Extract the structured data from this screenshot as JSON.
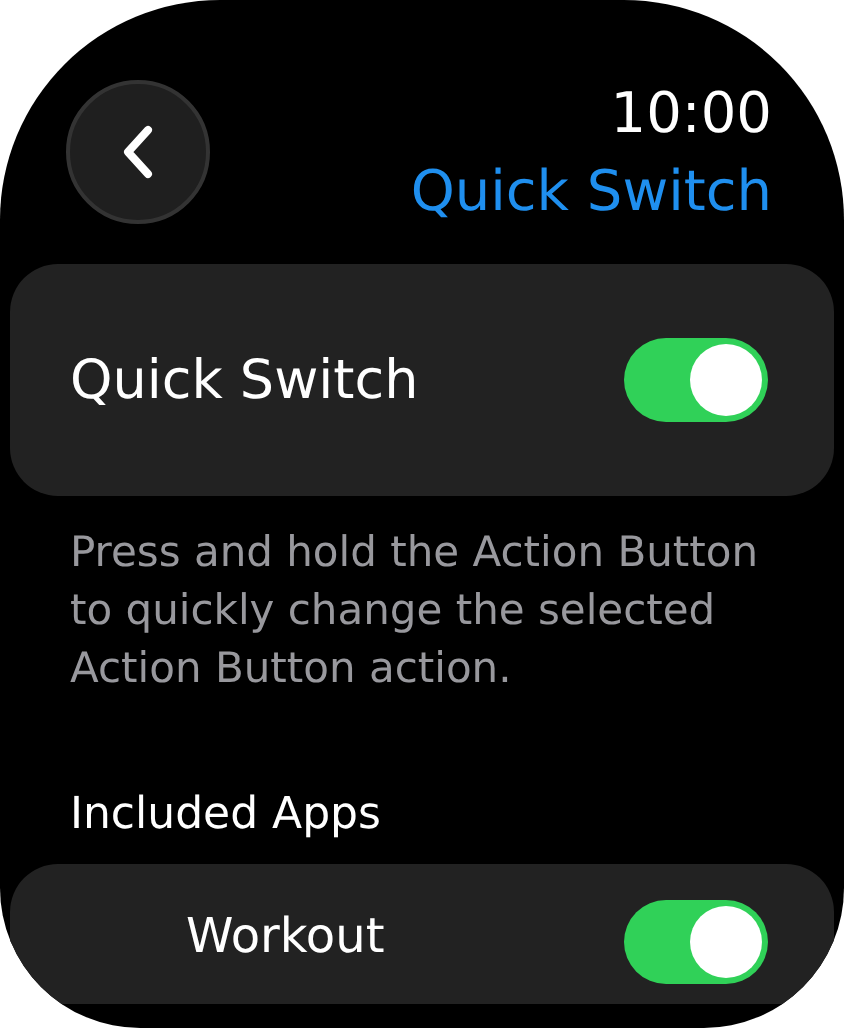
{
  "header": {
    "time": "10:00",
    "title": "Quick Switch"
  },
  "main_setting": {
    "label": "Quick Switch",
    "on": true
  },
  "description": "Press and hold the Action Button to quickly change the selected Action Button action.",
  "section_title": "Included Apps",
  "apps": [
    {
      "label": "Workout",
      "on": true
    }
  ]
}
